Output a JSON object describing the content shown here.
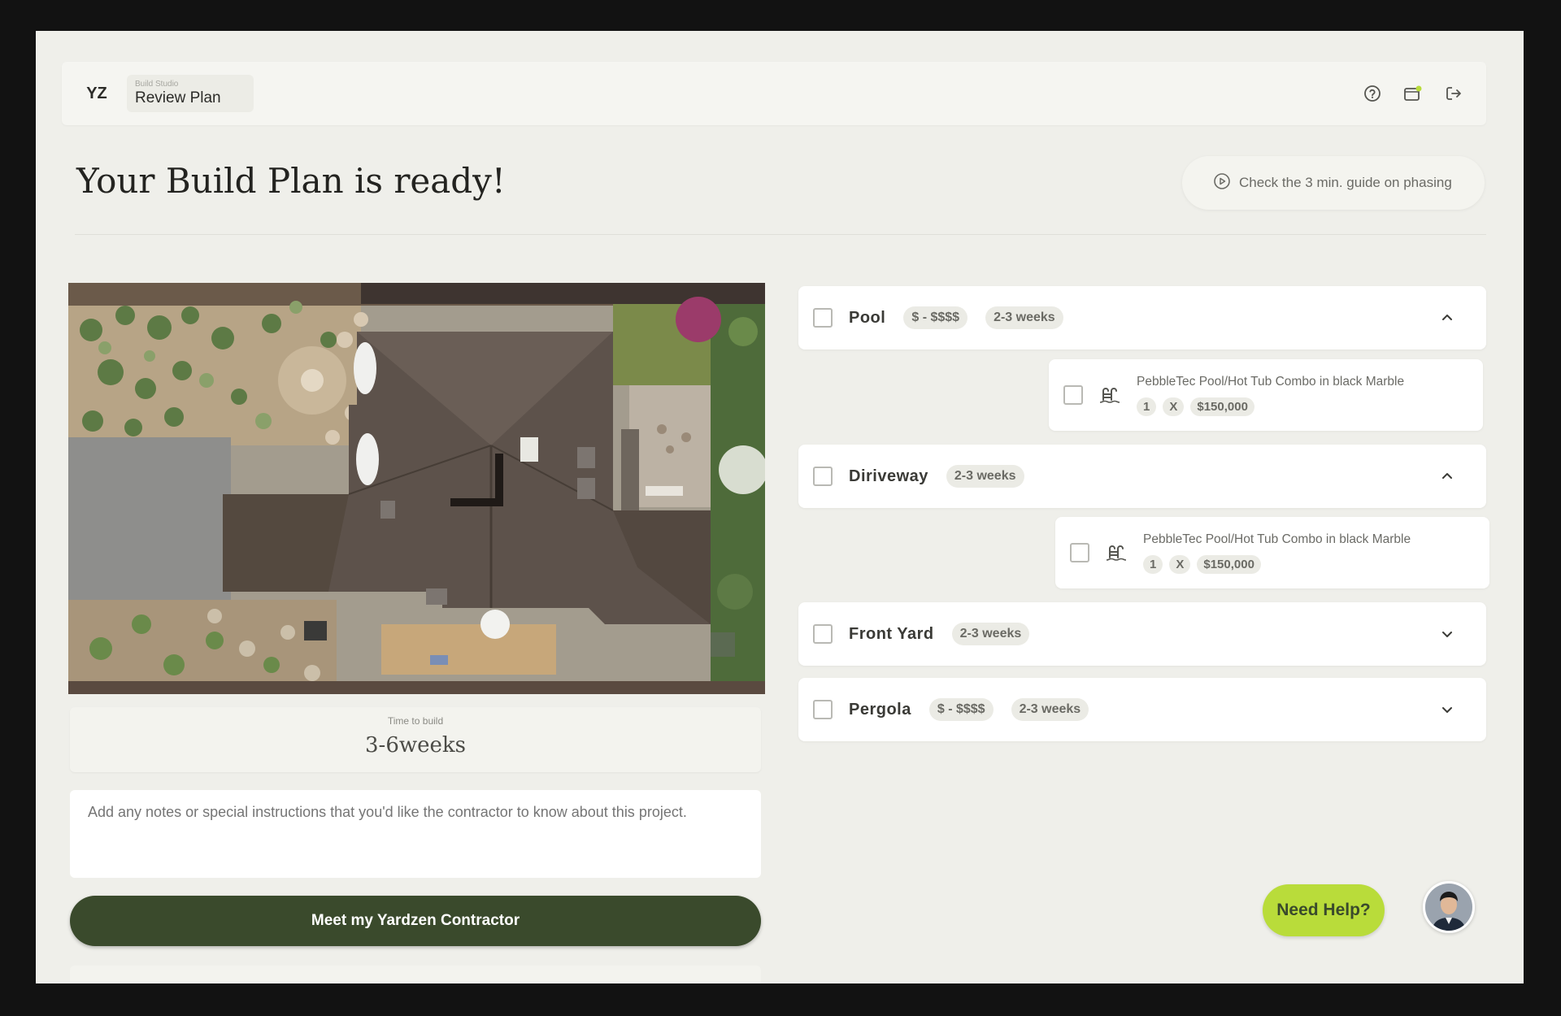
{
  "header": {
    "logo": "YZ",
    "breadcrumb_small": "Build Studio",
    "title": "Review Plan",
    "icons": [
      "help-circle-icon",
      "notification-icon",
      "logout-icon"
    ]
  },
  "page": {
    "heading": "Your Build Plan is ready!",
    "guide_button": "Check the 3 min. guide on phasing"
  },
  "left": {
    "time_label": "Time to build",
    "time_value": "3-6weeks",
    "notes_placeholder": "Add any notes or special instructions that you'd like the contractor to know about this project.",
    "cta_label": "Meet my Yardzen Contractor"
  },
  "phases": [
    {
      "label": "Pool",
      "price": "$ - $$$$",
      "duration": "2-3 weeks",
      "expanded": true
    },
    {
      "label": "Diriveway",
      "price": "",
      "duration": "2-3 weeks",
      "expanded": true
    },
    {
      "label": "Front Yard",
      "price": "",
      "duration": "2-3 weeks",
      "expanded": false
    },
    {
      "label": "Pergola",
      "price": "$ - $$$$",
      "duration": "2-3 weeks",
      "expanded": false
    }
  ],
  "items": [
    {
      "title": "PebbleTec Pool/Hot Tub Combo in black Marble",
      "qty": "1",
      "times": "X",
      "price": "$150,000",
      "icon": "pool-ladder-icon"
    },
    {
      "title": "PebbleTec Pool/Hot Tub Combo in black Marble",
      "qty": "1",
      "times": "X",
      "price": "$150,000",
      "icon": "pool-ladder-icon"
    }
  ],
  "help": {
    "label": "Need Help?"
  },
  "colors": {
    "primary": "#3a4a2c",
    "accent": "#b9dc3a",
    "background": "#efefea"
  }
}
